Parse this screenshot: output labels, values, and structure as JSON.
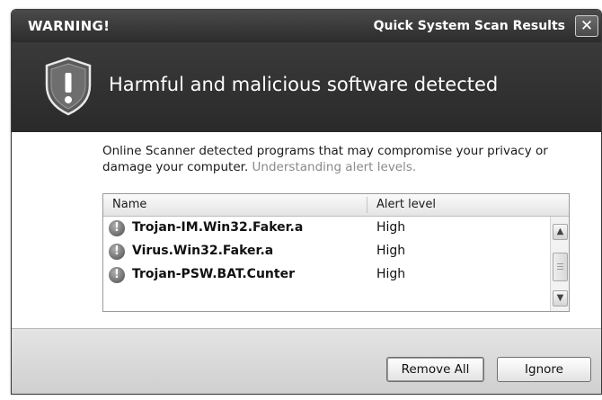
{
  "window": {
    "title_left": "WARNING!",
    "title_right": "Quick System Scan Results",
    "close_glyph": "✕"
  },
  "banner": {
    "icon": "shield-exclamation-icon",
    "message": "Harmful and malicious software detected"
  },
  "description": {
    "text": "Online Scanner detected programs that may compromise your privacy or damage your computer.",
    "link": "Understanding alert levels."
  },
  "list": {
    "columns": [
      "Name",
      "Alert level"
    ],
    "rows": [
      {
        "icon": "alert-icon",
        "name": "Trojan-IM.Win32.Faker.a",
        "level": "High"
      },
      {
        "icon": "alert-icon",
        "name": "Virus.Win32.Faker.a",
        "level": "High"
      },
      {
        "icon": "alert-icon",
        "name": "Trojan-PSW.BAT.Cunter",
        "level": "High"
      }
    ]
  },
  "buttons": {
    "remove_all": "Remove All",
    "ignore": "Ignore"
  },
  "colors": {
    "titlebar": "#2c2c2c",
    "banner": "#333333",
    "footer": "#d6d6d6"
  }
}
